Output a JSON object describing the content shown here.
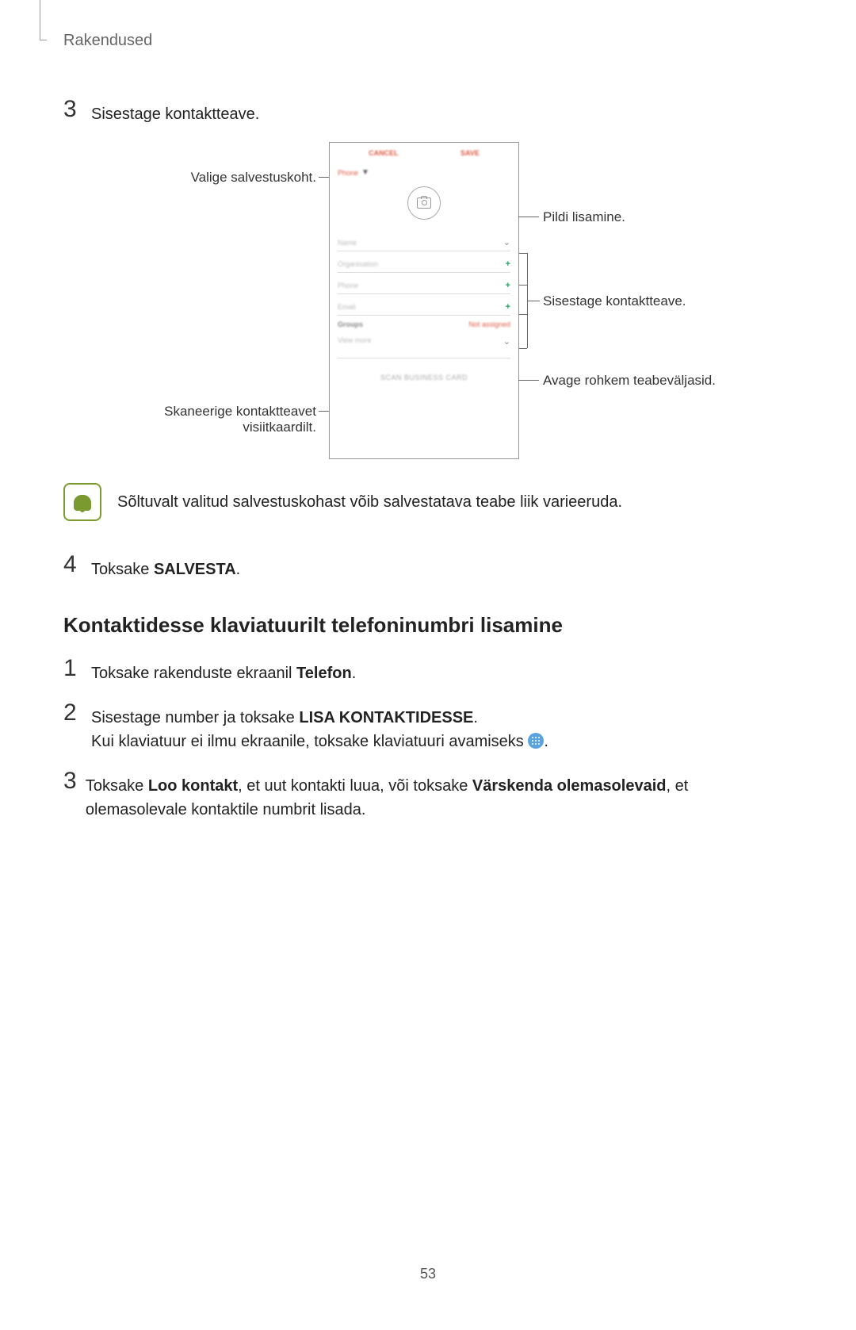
{
  "header": "Rakendused",
  "step3": {
    "num": "3",
    "text": "Sisestage kontaktteave."
  },
  "diagram": {
    "left": {
      "storage": "Valige salvestuskoht.",
      "scan_l1": "Skaneerige kontaktteavet",
      "scan_l2": "visiitkaardilt."
    },
    "right": {
      "image": "Pildi lisamine.",
      "info": "Sisestage kontaktteave.",
      "more": "Avage rohkem teabeväljasid."
    },
    "phone": {
      "cancel": "CANCEL",
      "save": "SAVE",
      "storage": "Phone",
      "name": "Name",
      "org": "Organisation",
      "phone": "Phone",
      "email": "Email",
      "groups": "Groups",
      "groups_val": "Not assigned",
      "more": "View more",
      "scan": "SCAN BUSINESS CARD"
    }
  },
  "note": "Sõltuvalt valitud salvestuskohast võib salvestatava teabe liik varieeruda.",
  "step4": {
    "num": "4",
    "text_a": "Toksake ",
    "text_b": "SALVESTA",
    "text_c": "."
  },
  "subheading": "Kontaktidesse klaviatuurilt telefoninumbri lisamine",
  "sub_steps": {
    "s1": {
      "num": "1",
      "a": "Toksake rakenduste ekraanil ",
      "b": "Telefon",
      "c": "."
    },
    "s2": {
      "num": "2",
      "l1a": "Sisestage number ja toksake ",
      "l1b": "LISA KONTAKTIDESSE",
      "l1c": ".",
      "l2a": "Kui klaviatuur ei ilmu ekraanile, toksake klaviatuuri avamiseks ",
      "l2b": "."
    },
    "s3": {
      "num": "3",
      "a": "Toksake ",
      "b": "Loo kontakt",
      "c": ", et uut kontakti luua, või toksake ",
      "d": "Värskenda olemasolevaid",
      "e": ", et olemasolevale kontaktile numbrit lisada."
    }
  },
  "page_num": "53"
}
